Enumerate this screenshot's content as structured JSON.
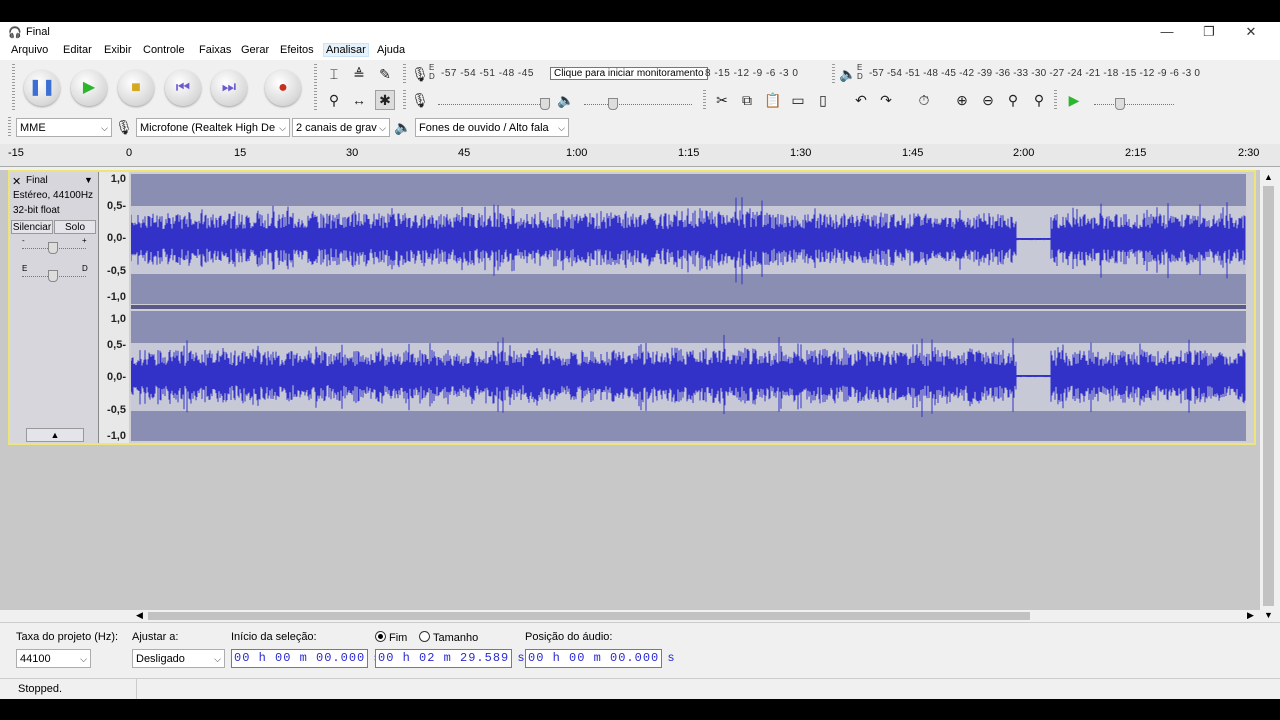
{
  "window": {
    "title": "Final"
  },
  "menu": [
    "Arquivo",
    "Editar",
    "Exibir",
    "Controle",
    "Faixas",
    "Gerar",
    "Efeitos",
    "Analisar",
    "Ajuda"
  ],
  "meters": {
    "record_scale": "-57 -54 -51 -48 -45",
    "record_scale_right": "8 -15 -12 -9 -6 -3 0",
    "tooltip": "Clique para iniciar monitoramento",
    "play_scale": "-57 -54 -51 -48 -45 -42 -39 -36 -33 -30 -27 -24 -21 -18 -15 -12 -9 -6 -3 0",
    "rec_letters": "E\nD",
    "play_letters": "E\nD"
  },
  "devices": {
    "host": "MME",
    "mic": "Microfone (Realtek High De",
    "channels": "2 canais de grav",
    "output": "Fones de ouvido / Alto fala"
  },
  "ruler": {
    "ticks": [
      "-15",
      "0",
      "15",
      "30",
      "45",
      "1:00",
      "1:15",
      "1:30",
      "1:45",
      "2:00",
      "2:15",
      "2:30"
    ]
  },
  "track": {
    "name": "Final",
    "info1": "Estéreo, 44100Hz",
    "info2": "32-bit float",
    "mute": "Silenciar",
    "solo": "Solo",
    "gain_minus": "-",
    "gain_plus": "+",
    "pan_left": "E",
    "pan_right": "D",
    "scale": [
      "1,0",
      "0,5-",
      "0,0-",
      "-0,5",
      "-1,0"
    ]
  },
  "selection": {
    "rate_label": "Taxa do projeto (Hz):",
    "rate_value": "44100",
    "snap_label": "Ajustar a:",
    "snap_value": "Desligado",
    "start_label": "Início da seleção:",
    "start_value": "00 h 00 m 00.000 s",
    "end_radio": "Fim",
    "length_radio": "Tamanho",
    "end_value": "00 h 02 m 29.589 s",
    "pos_label": "Posição do áudio:",
    "pos_value": "00 h 00 m 00.000 s"
  },
  "status": "Stopped.",
  "colors": {
    "waveform": "#3232c8",
    "track_bg": "#8a8eb2",
    "clip_mid": "#c8c9d6",
    "selected_border": "#ede47a"
  }
}
